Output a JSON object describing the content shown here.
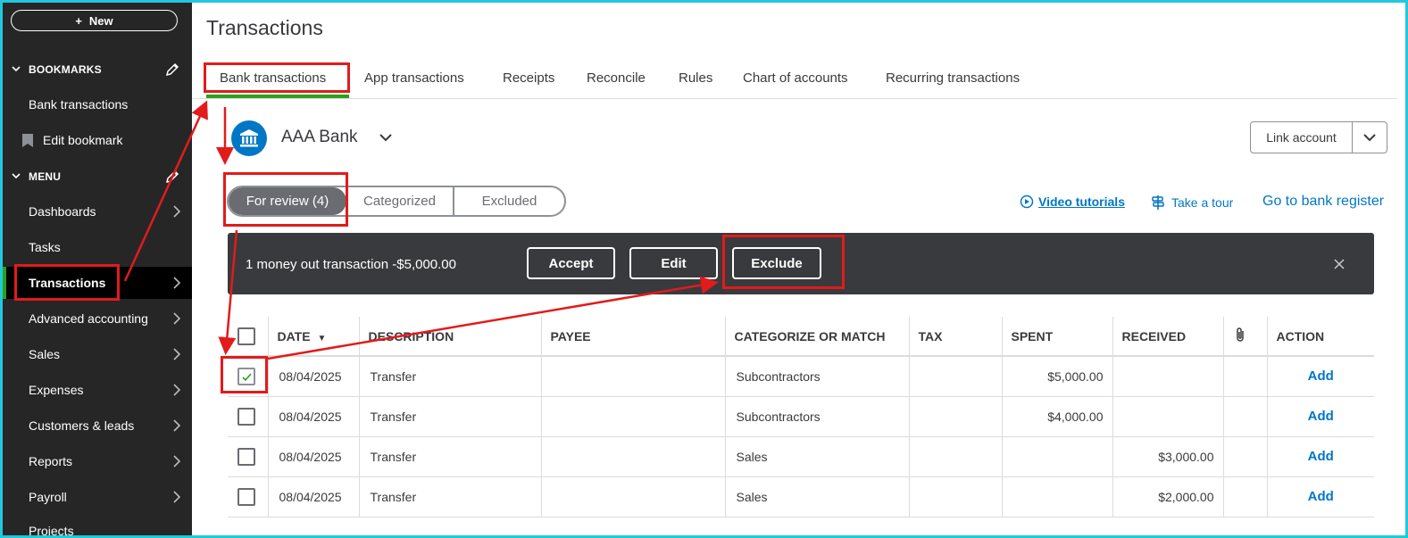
{
  "sidebar": {
    "new_label": "New",
    "bookmarks_header": "BOOKMARKS",
    "bookmarks": [
      "Bank transactions",
      "Edit bookmark"
    ],
    "menu_header": "MENU",
    "menu_items": [
      "Dashboards",
      "Tasks",
      "Transactions",
      "Advanced accounting",
      "Sales",
      "Expenses",
      "Customers & leads",
      "Reports",
      "Payroll",
      "Projects"
    ],
    "active_item": "Transactions"
  },
  "page": {
    "title": "Transactions"
  },
  "tabs": [
    "Bank transactions",
    "App transactions",
    "Receipts",
    "Reconcile",
    "Rules",
    "Chart of accounts",
    "Recurring transactions"
  ],
  "bank": {
    "name": "AAA Bank",
    "link_account": "Link account"
  },
  "filters": {
    "for_review": "For review (4)",
    "categorized": "Categorized",
    "excluded": "Excluded"
  },
  "links": {
    "video_tutorials": "Video tutorials",
    "take_tour": "Take a tour",
    "bank_register": "Go to bank register"
  },
  "batch_bar": {
    "message": "1 money out transaction -$5,000.00",
    "accept": "Accept",
    "edit": "Edit",
    "exclude": "Exclude"
  },
  "table": {
    "headers": [
      "DATE",
      "DESCRIPTION",
      "PAYEE",
      "CATEGORIZE OR MATCH",
      "TAX",
      "SPENT",
      "RECEIVED",
      "ACTION"
    ],
    "rows": [
      {
        "checked": true,
        "date": "08/04/2025",
        "description": "Transfer",
        "payee": "",
        "category": "Subcontractors",
        "tax": "",
        "spent": "$5,000.00",
        "received": "",
        "action": "Add"
      },
      {
        "checked": false,
        "date": "08/04/2025",
        "description": "Transfer",
        "payee": "",
        "category": "Subcontractors",
        "tax": "",
        "spent": "$4,000.00",
        "received": "",
        "action": "Add"
      },
      {
        "checked": false,
        "date": "08/04/2025",
        "description": "Transfer",
        "payee": "",
        "category": "Sales",
        "tax": "",
        "spent": "",
        "received": "$3,000.00",
        "action": "Add"
      },
      {
        "checked": false,
        "date": "08/04/2025",
        "description": "Transfer",
        "payee": "",
        "category": "Sales",
        "tax": "",
        "spent": "",
        "received": "$2,000.00",
        "action": "Add"
      }
    ]
  },
  "colors": {
    "brand_green": "#2ca01c",
    "link_blue": "#0077c5",
    "annotation_red": "#e21b1b",
    "sidebar_bg": "#262626",
    "frame": "#22c7e0"
  }
}
